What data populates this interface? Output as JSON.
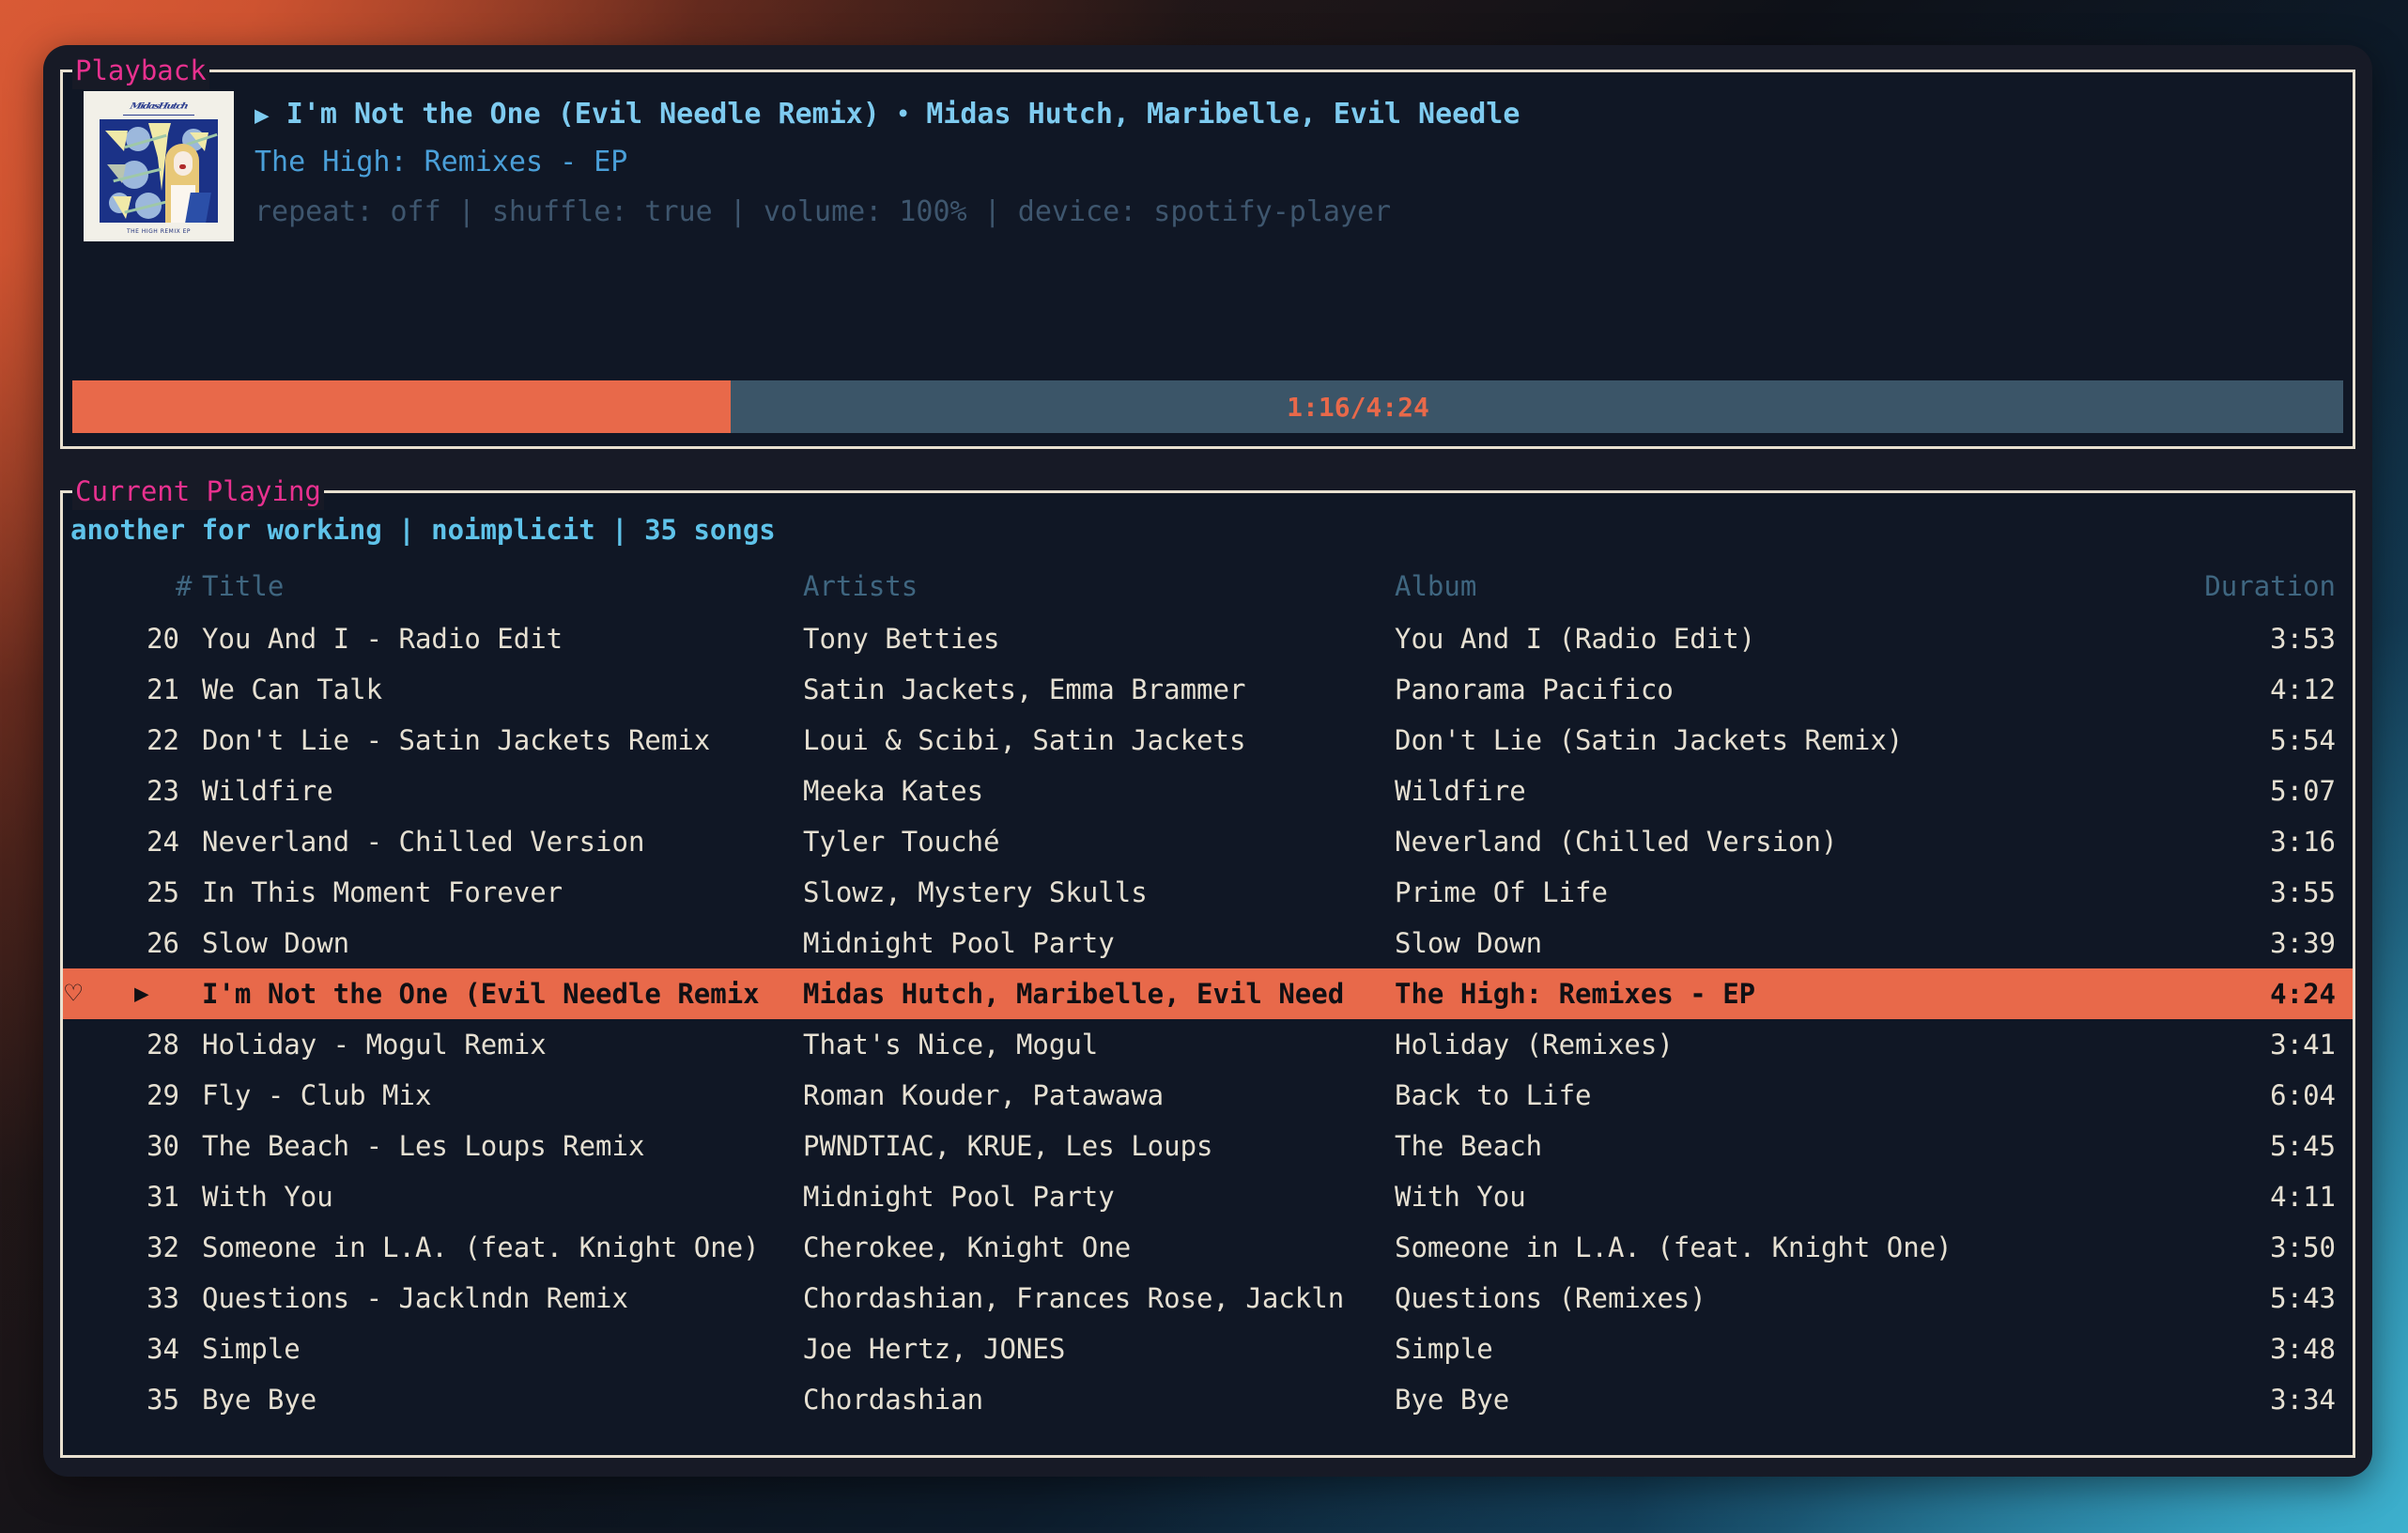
{
  "colors": {
    "accent_orange": "#e8694a",
    "panel_border": "#e8e0d0",
    "panel_title": "#e8318f",
    "track_title": "#7ecbf0",
    "track_album": "#4a9fd8",
    "track_meta": "#3e566e",
    "row_text": "#e6e0d2",
    "header_text": "#3f6680",
    "progress_track": "#3b5568",
    "window_bg": "#171a26",
    "panel_bg": "#101725"
  },
  "playback": {
    "panel_title": "Playback",
    "play_icon": "▶",
    "separator": "•",
    "track_title": "I'm Not the One (Evil Needle Remix)",
    "artists": "Midas Hutch, Maribelle, Evil Needle",
    "album": "The High: Remixes - EP",
    "meta": "repeat: off | shuffle: true | volume: 100% | device: spotify-player",
    "repeat": "off",
    "shuffle": "true",
    "volume": "100%",
    "device": "spotify-player",
    "album_art": {
      "logo_text": "MidasHutch",
      "caption": "THE HIGH REMIX EP"
    },
    "progress": {
      "elapsed": "1:16",
      "total": "4:24",
      "label": "1:16/4:24",
      "percent": 29
    }
  },
  "playlist": {
    "panel_title": "Current Playing",
    "name": "another for working",
    "visibility": "noimplicit",
    "count": "35 songs",
    "meta_line": "another for working | noimplicit | 35 songs",
    "columns": [
      "#",
      "Title",
      "Artists",
      "Album",
      "Duration"
    ],
    "heart_icon": "♡",
    "play_icon": "▶",
    "rows": [
      {
        "num": "20",
        "title": "You And I - Radio Edit",
        "artists": "Tony Betties",
        "album": "You And I (Radio Edit)",
        "duration": "3:53",
        "active": false
      },
      {
        "num": "21",
        "title": "We Can Talk",
        "artists": "Satin Jackets, Emma Brammer",
        "album": "Panorama Pacifico",
        "duration": "4:12",
        "active": false
      },
      {
        "num": "22",
        "title": "Don't Lie - Satin Jackets Remix",
        "artists": "Loui & Scibi, Satin Jackets",
        "album": "Don't Lie (Satin Jackets Remix)",
        "duration": "5:54",
        "active": false
      },
      {
        "num": "23",
        "title": "Wildfire",
        "artists": "Meeka Kates",
        "album": "Wildfire",
        "duration": "5:07",
        "active": false
      },
      {
        "num": "24",
        "title": "Neverland - Chilled Version",
        "artists": "Tyler Touché",
        "album": "Neverland (Chilled Version)",
        "duration": "3:16",
        "active": false
      },
      {
        "num": "25",
        "title": "In This Moment Forever",
        "artists": "Slowz, Mystery Skulls",
        "album": "Prime Of Life",
        "duration": "3:55",
        "active": false
      },
      {
        "num": "26",
        "title": "Slow Down",
        "artists": "Midnight Pool Party",
        "album": "Slow Down",
        "duration": "3:39",
        "active": false
      },
      {
        "num": "",
        "title": "I'm Not the One (Evil Needle Remix",
        "artists": "Midas Hutch, Maribelle, Evil Need",
        "album": "The High: Remixes - EP",
        "duration": "4:24",
        "active": true
      },
      {
        "num": "28",
        "title": "Holiday - Mogul Remix",
        "artists": "That's Nice, Mogul",
        "album": "Holiday (Remixes)",
        "duration": "3:41",
        "active": false
      },
      {
        "num": "29",
        "title": "Fly - Club Mix",
        "artists": "Roman Kouder, Patawawa",
        "album": "Back to Life",
        "duration": "6:04",
        "active": false
      },
      {
        "num": "30",
        "title": "The Beach - Les Loups Remix",
        "artists": "PWNDTIAC, KRUE, Les Loups",
        "album": "The Beach",
        "duration": "5:45",
        "active": false
      },
      {
        "num": "31",
        "title": "With You",
        "artists": "Midnight Pool Party",
        "album": "With You",
        "duration": "4:11",
        "active": false
      },
      {
        "num": "32",
        "title": "Someone in L.A. (feat. Knight One)",
        "artists": "Cherokee, Knight One",
        "album": "Someone in L.A. (feat. Knight One)",
        "duration": "3:50",
        "active": false
      },
      {
        "num": "33",
        "title": "Questions - Jacklndn Remix",
        "artists": "Chordashian, Frances Rose, Jackln",
        "album": "Questions (Remixes)",
        "duration": "5:43",
        "active": false
      },
      {
        "num": "34",
        "title": "Simple",
        "artists": "Joe Hertz, JONES",
        "album": "Simple",
        "duration": "3:48",
        "active": false
      },
      {
        "num": "35",
        "title": "Bye Bye",
        "artists": "Chordashian",
        "album": "Bye Bye",
        "duration": "3:34",
        "active": false
      }
    ]
  }
}
